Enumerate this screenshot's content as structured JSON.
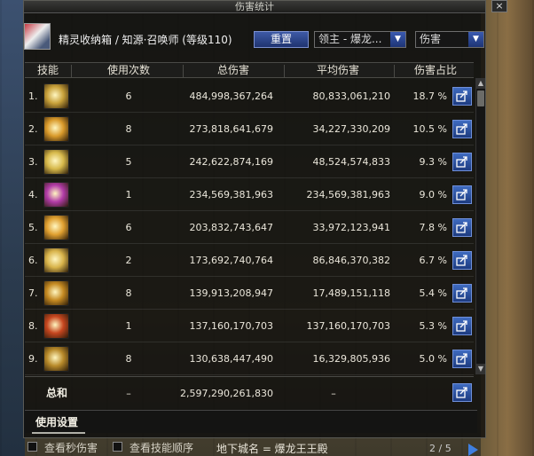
{
  "window": {
    "title": "伤害统计",
    "close_label": "×"
  },
  "header": {
    "character": "精灵收纳箱 / 知源·召唤师 (等级110)",
    "reset_label": "重置",
    "target_select": "领主 - 爆龙...",
    "type_select": "伤害"
  },
  "columns": {
    "skill": "技能",
    "count": "使用次数",
    "total": "总伤害",
    "avg": "平均伤害",
    "pct": "伤害占比"
  },
  "rows": [
    {
      "idx": "1.",
      "count": "6",
      "total": "484,998,367,264",
      "avg": "80,833,061,210",
      "pct": "18.7 %",
      "icon_color": "#c8a13a",
      "icon": "skill-icon-1"
    },
    {
      "idx": "2.",
      "count": "8",
      "total": "273,818,641,679",
      "avg": "34,227,330,209",
      "pct": "10.5 %",
      "icon_color": "#d99a2b",
      "icon": "skill-icon-2"
    },
    {
      "idx": "3.",
      "count": "5",
      "total": "242,622,874,169",
      "avg": "48,524,574,833",
      "pct": "9.3 %",
      "icon_color": "#d6b84a",
      "icon": "skill-icon-3"
    },
    {
      "idx": "4.",
      "count": "1",
      "total": "234,569,381,963",
      "avg": "234,569,381,963",
      "pct": "9.0 %",
      "icon_color": "#b23ca8",
      "icon": "skill-icon-4"
    },
    {
      "idx": "5.",
      "count": "6",
      "total": "203,832,743,647",
      "avg": "33,972,123,941",
      "pct": "7.8 %",
      "icon_color": "#e0a030",
      "icon": "skill-icon-5"
    },
    {
      "idx": "6.",
      "count": "2",
      "total": "173,692,740,764",
      "avg": "86,846,370,382",
      "pct": "6.7 %",
      "icon_color": "#d8b34a",
      "icon": "skill-icon-6"
    },
    {
      "idx": "7.",
      "count": "8",
      "total": "139,913,208,947",
      "avg": "17,489,151,118",
      "pct": "5.4 %",
      "icon_color": "#c58a22",
      "icon": "skill-icon-7"
    },
    {
      "idx": "8.",
      "count": "1",
      "total": "137,160,170,703",
      "avg": "137,160,170,703",
      "pct": "5.3 %",
      "icon_color": "#c6461f",
      "icon": "skill-icon-8"
    },
    {
      "idx": "9.",
      "count": "8",
      "total": "130,638,447,490",
      "avg": "16,329,805,936",
      "pct": "5.0 %",
      "icon_color": "#b88a2a",
      "icon": "skill-icon-9"
    }
  ],
  "total": {
    "label": "总和",
    "count": "–",
    "total": "2,597,290,261,830",
    "avg": "–"
  },
  "settings": {
    "label": "使用设置"
  },
  "options": {
    "per_second": "查看秒伤害",
    "skill_order": "查看技能顺序"
  },
  "location": "地下城名 = 爆龙王王殿",
  "page": "2 / 5",
  "colors": {
    "accent": "#3f6bc0",
    "panel": "#0c0c0c"
  }
}
